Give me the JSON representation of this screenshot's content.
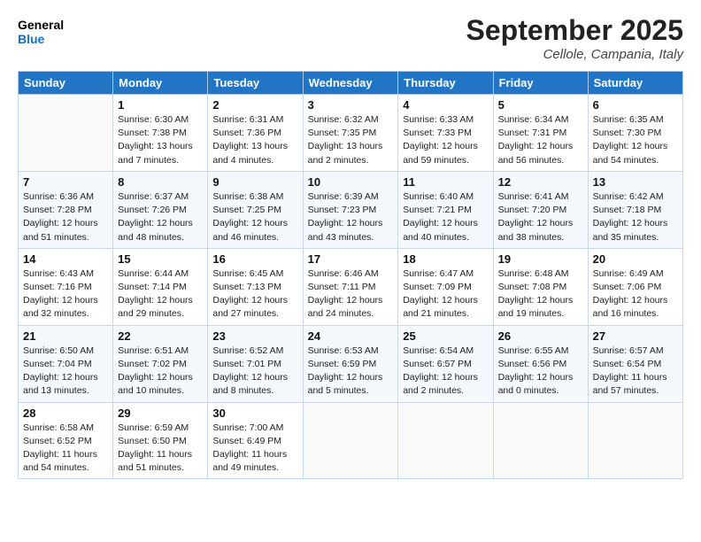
{
  "header": {
    "logo_line1": "General",
    "logo_line2": "Blue",
    "month": "September 2025",
    "location": "Cellole, Campania, Italy"
  },
  "weekdays": [
    "Sunday",
    "Monday",
    "Tuesday",
    "Wednesday",
    "Thursday",
    "Friday",
    "Saturday"
  ],
  "weeks": [
    [
      {
        "day": "",
        "info": ""
      },
      {
        "day": "1",
        "info": "Sunrise: 6:30 AM\nSunset: 7:38 PM\nDaylight: 13 hours\nand 7 minutes."
      },
      {
        "day": "2",
        "info": "Sunrise: 6:31 AM\nSunset: 7:36 PM\nDaylight: 13 hours\nand 4 minutes."
      },
      {
        "day": "3",
        "info": "Sunrise: 6:32 AM\nSunset: 7:35 PM\nDaylight: 13 hours\nand 2 minutes."
      },
      {
        "day": "4",
        "info": "Sunrise: 6:33 AM\nSunset: 7:33 PM\nDaylight: 12 hours\nand 59 minutes."
      },
      {
        "day": "5",
        "info": "Sunrise: 6:34 AM\nSunset: 7:31 PM\nDaylight: 12 hours\nand 56 minutes."
      },
      {
        "day": "6",
        "info": "Sunrise: 6:35 AM\nSunset: 7:30 PM\nDaylight: 12 hours\nand 54 minutes."
      }
    ],
    [
      {
        "day": "7",
        "info": "Sunrise: 6:36 AM\nSunset: 7:28 PM\nDaylight: 12 hours\nand 51 minutes."
      },
      {
        "day": "8",
        "info": "Sunrise: 6:37 AM\nSunset: 7:26 PM\nDaylight: 12 hours\nand 48 minutes."
      },
      {
        "day": "9",
        "info": "Sunrise: 6:38 AM\nSunset: 7:25 PM\nDaylight: 12 hours\nand 46 minutes."
      },
      {
        "day": "10",
        "info": "Sunrise: 6:39 AM\nSunset: 7:23 PM\nDaylight: 12 hours\nand 43 minutes."
      },
      {
        "day": "11",
        "info": "Sunrise: 6:40 AM\nSunset: 7:21 PM\nDaylight: 12 hours\nand 40 minutes."
      },
      {
        "day": "12",
        "info": "Sunrise: 6:41 AM\nSunset: 7:20 PM\nDaylight: 12 hours\nand 38 minutes."
      },
      {
        "day": "13",
        "info": "Sunrise: 6:42 AM\nSunset: 7:18 PM\nDaylight: 12 hours\nand 35 minutes."
      }
    ],
    [
      {
        "day": "14",
        "info": "Sunrise: 6:43 AM\nSunset: 7:16 PM\nDaylight: 12 hours\nand 32 minutes."
      },
      {
        "day": "15",
        "info": "Sunrise: 6:44 AM\nSunset: 7:14 PM\nDaylight: 12 hours\nand 29 minutes."
      },
      {
        "day": "16",
        "info": "Sunrise: 6:45 AM\nSunset: 7:13 PM\nDaylight: 12 hours\nand 27 minutes."
      },
      {
        "day": "17",
        "info": "Sunrise: 6:46 AM\nSunset: 7:11 PM\nDaylight: 12 hours\nand 24 minutes."
      },
      {
        "day": "18",
        "info": "Sunrise: 6:47 AM\nSunset: 7:09 PM\nDaylight: 12 hours\nand 21 minutes."
      },
      {
        "day": "19",
        "info": "Sunrise: 6:48 AM\nSunset: 7:08 PM\nDaylight: 12 hours\nand 19 minutes."
      },
      {
        "day": "20",
        "info": "Sunrise: 6:49 AM\nSunset: 7:06 PM\nDaylight: 12 hours\nand 16 minutes."
      }
    ],
    [
      {
        "day": "21",
        "info": "Sunrise: 6:50 AM\nSunset: 7:04 PM\nDaylight: 12 hours\nand 13 minutes."
      },
      {
        "day": "22",
        "info": "Sunrise: 6:51 AM\nSunset: 7:02 PM\nDaylight: 12 hours\nand 10 minutes."
      },
      {
        "day": "23",
        "info": "Sunrise: 6:52 AM\nSunset: 7:01 PM\nDaylight: 12 hours\nand 8 minutes."
      },
      {
        "day": "24",
        "info": "Sunrise: 6:53 AM\nSunset: 6:59 PM\nDaylight: 12 hours\nand 5 minutes."
      },
      {
        "day": "25",
        "info": "Sunrise: 6:54 AM\nSunset: 6:57 PM\nDaylight: 12 hours\nand 2 minutes."
      },
      {
        "day": "26",
        "info": "Sunrise: 6:55 AM\nSunset: 6:56 PM\nDaylight: 12 hours\nand 0 minutes."
      },
      {
        "day": "27",
        "info": "Sunrise: 6:57 AM\nSunset: 6:54 PM\nDaylight: 11 hours\nand 57 minutes."
      }
    ],
    [
      {
        "day": "28",
        "info": "Sunrise: 6:58 AM\nSunset: 6:52 PM\nDaylight: 11 hours\nand 54 minutes."
      },
      {
        "day": "29",
        "info": "Sunrise: 6:59 AM\nSunset: 6:50 PM\nDaylight: 11 hours\nand 51 minutes."
      },
      {
        "day": "30",
        "info": "Sunrise: 7:00 AM\nSunset: 6:49 PM\nDaylight: 11 hours\nand 49 minutes."
      },
      {
        "day": "",
        "info": ""
      },
      {
        "day": "",
        "info": ""
      },
      {
        "day": "",
        "info": ""
      },
      {
        "day": "",
        "info": ""
      }
    ]
  ]
}
